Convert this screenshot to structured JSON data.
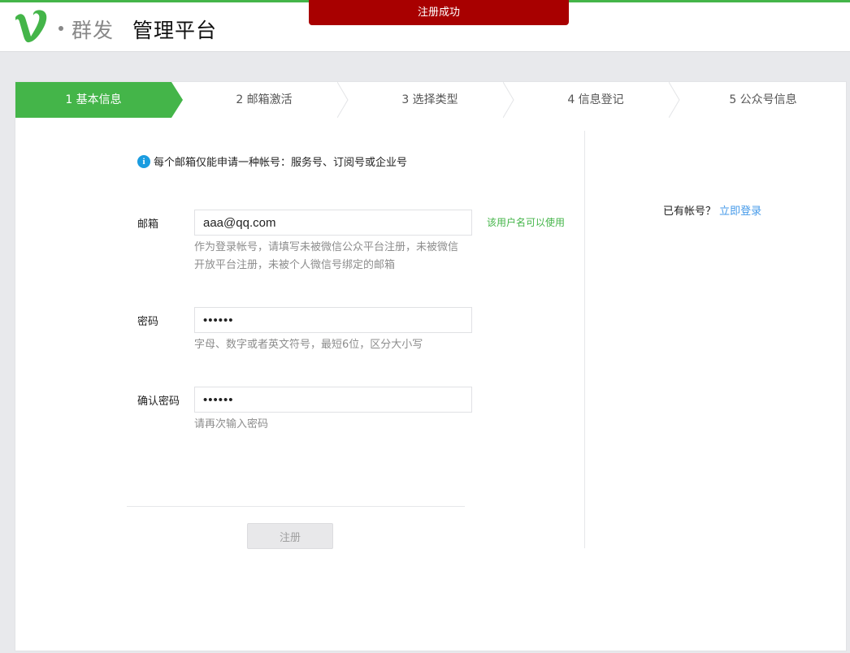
{
  "colors": {
    "brand_green": "#44b549",
    "toast_red": "#a80000",
    "link_blue": "#459ae9",
    "info_blue": "#1a9ce0"
  },
  "header": {
    "logo_icon": "v-logo-icon",
    "brand": "群发",
    "title": "管理平台"
  },
  "toast": {
    "message": "注册成功"
  },
  "steps": [
    {
      "label": "1 基本信息",
      "active": true
    },
    {
      "label": "2 邮箱激活",
      "active": false
    },
    {
      "label": "3 选择类型",
      "active": false
    },
    {
      "label": "4 信息登记",
      "active": false
    },
    {
      "label": "5 公众号信息",
      "active": false
    }
  ],
  "notice": {
    "icon": "info-icon",
    "text": "每个邮箱仅能申请一种帐号：服务号、订阅号或企业号"
  },
  "form": {
    "email": {
      "label": "邮箱",
      "value": "aaa@qq.com",
      "hint": "作为登录帐号，请填写未被微信公众平台注册，未被微信开放平台注册，未被个人微信号绑定的邮箱",
      "valid_text": "该用户名可以使用"
    },
    "password": {
      "label": "密码",
      "value": "••••••",
      "hint": "字母、数字或者英文符号，最短6位，区分大小写"
    },
    "confirm": {
      "label": "确认密码",
      "value": "••••••",
      "hint": "请再次输入密码"
    },
    "submit_label": "注册"
  },
  "side": {
    "prompt": "已有帐号？",
    "link": "立即登录"
  }
}
